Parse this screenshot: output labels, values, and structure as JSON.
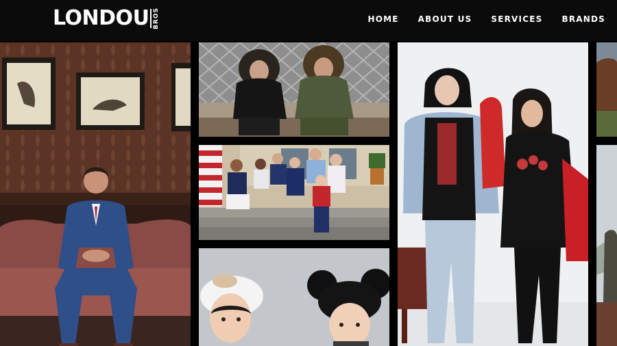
{
  "brand": {
    "name": "LONDOU",
    "sub": "BROS"
  },
  "nav": {
    "items": [
      {
        "label": "HOME"
      },
      {
        "label": "ABOUT US"
      },
      {
        "label": "SERVICES"
      },
      {
        "label": "BRANDS"
      }
    ]
  },
  "gallery": {
    "tiles": [
      {
        "name": "man-in-blue-suit-photo"
      },
      {
        "name": "two-people-in-parkas-photo"
      },
      {
        "name": "family-on-porch-photo"
      },
      {
        "name": "kids-in-hats-photo"
      },
      {
        "name": "couple-in-streetwear-photo"
      },
      {
        "name": "horse-photo"
      },
      {
        "name": "person-outdoors-photo"
      }
    ]
  }
}
